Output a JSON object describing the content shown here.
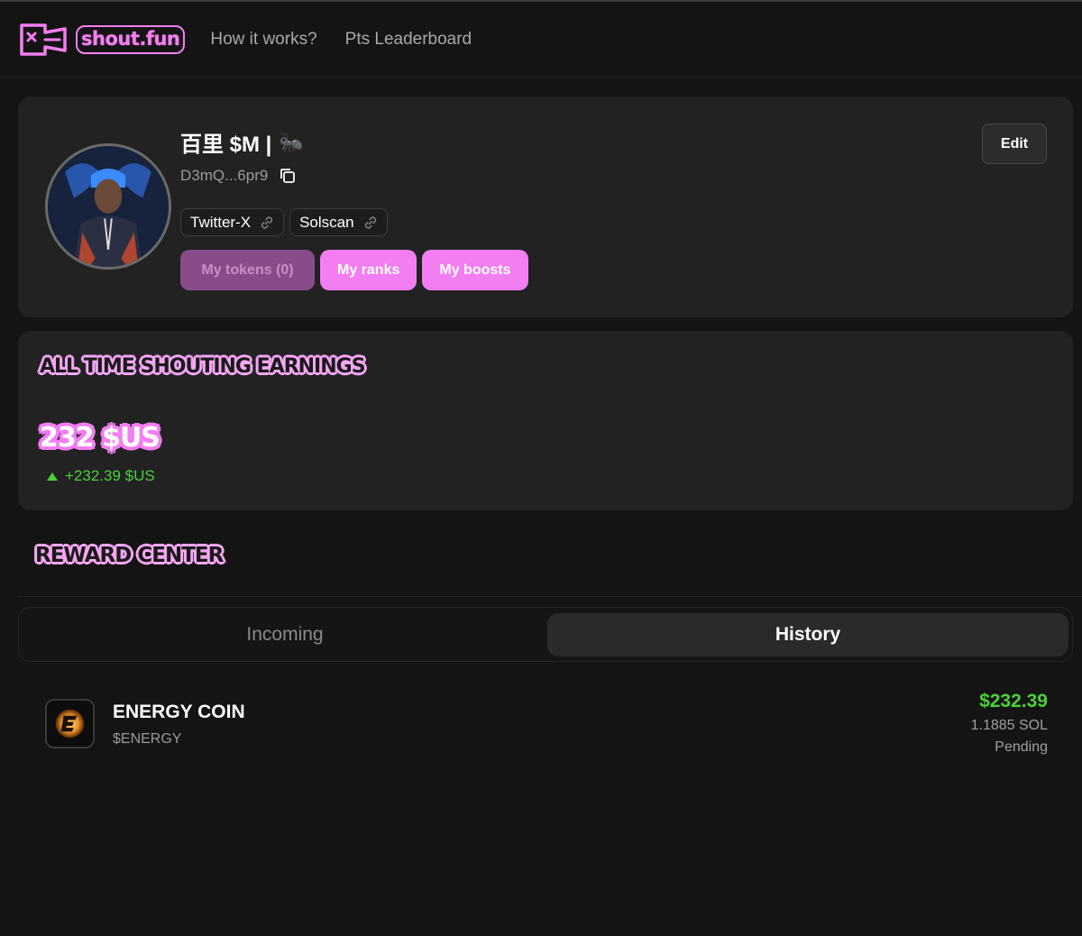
{
  "brand": {
    "name": "shout.fun",
    "accent": "#f27ef1"
  },
  "nav": {
    "items": [
      "How it works?",
      "Pts Leaderboard"
    ]
  },
  "profile": {
    "display_name": "百里 $M |",
    "address": "D3mQ...6pr9",
    "links": [
      "Twitter-X",
      "Solscan"
    ],
    "buttons": {
      "my_tokens": "My tokens (0)",
      "my_ranks": "My ranks",
      "my_boosts": "My boosts"
    },
    "edit_label": "Edit"
  },
  "earnings": {
    "title": "ALL TIME SHOUTING EARNINGS",
    "amount": "232 $US",
    "change": "+232.39 $US"
  },
  "reward_center": {
    "title": "REWARD CENTER",
    "tabs": {
      "incoming": "Incoming",
      "history": "History"
    },
    "active_tab": "History",
    "items": [
      {
        "name": "ENERGY COIN",
        "symbol": "$ENERGY",
        "usd": "$232.39",
        "sol": "1.1885 SOL",
        "status": "Pending"
      }
    ]
  },
  "colors": {
    "positive": "#4cd137",
    "card": "#222223",
    "background": "#141414"
  }
}
